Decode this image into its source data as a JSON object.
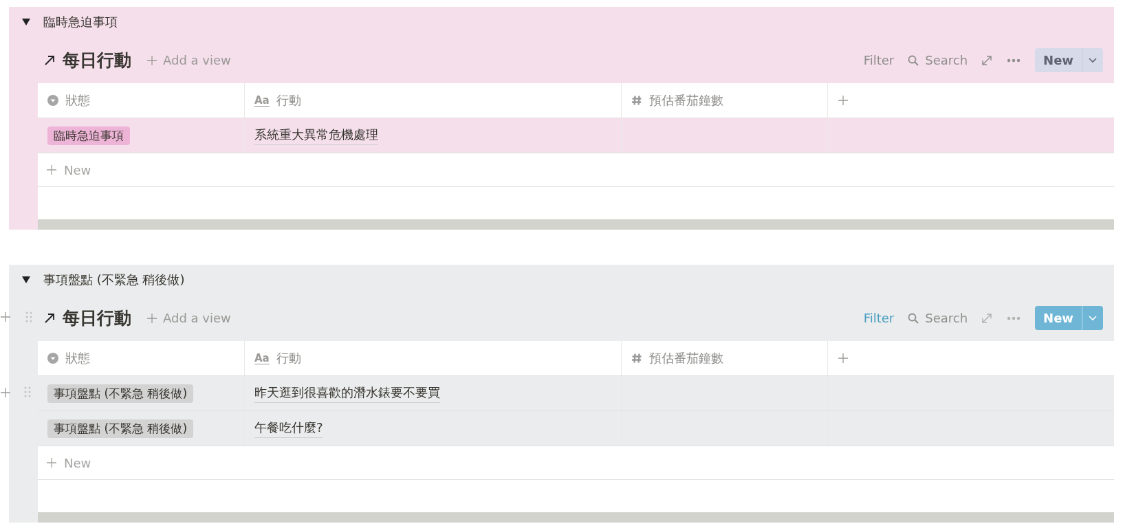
{
  "sections": [
    {
      "label": "臨時急迫事項",
      "color": "#f5dfeb",
      "handles": false,
      "view": {
        "title": "每日行動",
        "add_view": "Add a view",
        "toolbar": {
          "dimmed": true,
          "filter": "Filter",
          "search": "Search",
          "new": "New"
        }
      },
      "columns": [
        {
          "kind": "select",
          "label": "狀態"
        },
        {
          "kind": "text",
          "glyph": "Aa",
          "label": "行動"
        },
        {
          "kind": "number",
          "label": "預估番茄鐘數"
        },
        {
          "kind": "add"
        }
      ],
      "rows": [
        {
          "status": {
            "label": "臨時急迫事項",
            "color": "#eeb4d7"
          },
          "action": "系統重大異常危機處理",
          "hovered": false
        }
      ],
      "new_row": "New"
    },
    {
      "label": "事項盤點 (不緊急 稍後做)",
      "color": "#ebeced",
      "handles": true,
      "view": {
        "title": "每日行動",
        "add_view": "Add a view",
        "toolbar": {
          "dimmed": false,
          "filter": "Filter",
          "search": "Search",
          "new": "New"
        }
      },
      "columns": [
        {
          "kind": "select",
          "label": "狀態"
        },
        {
          "kind": "text",
          "glyph": "Aa",
          "label": "行動"
        },
        {
          "kind": "number",
          "label": "預估番茄鐘數"
        },
        {
          "kind": "add"
        }
      ],
      "rows": [
        {
          "status": {
            "label": "事項盤點 (不緊急 稍後做)",
            "color": "#d3d3d3"
          },
          "action": "昨天逛到很喜歡的潛水錶要不要買",
          "hovered": true
        },
        {
          "status": {
            "label": "事項盤點 (不緊急 稍後做)",
            "color": "#d3d3d3"
          },
          "action": "午餐吃什麼?",
          "hovered": false
        }
      ],
      "new_row": "New"
    }
  ]
}
